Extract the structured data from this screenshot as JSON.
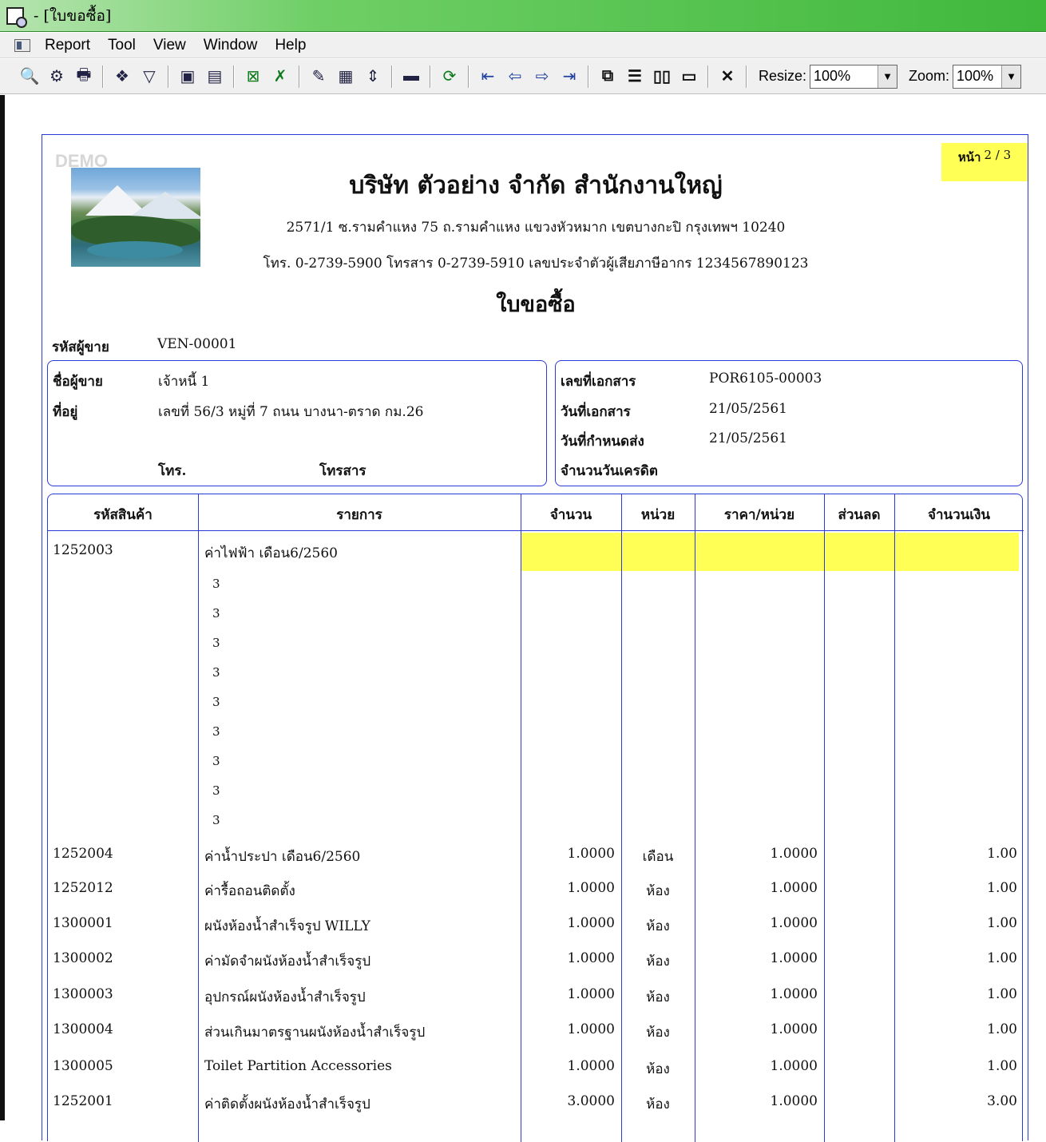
{
  "window": {
    "title": "- [ใบขอซื้อ]"
  },
  "menu": {
    "items": [
      "Report",
      "Tool",
      "View",
      "Window",
      "Help"
    ]
  },
  "toolbar": {
    "resize_label": "Resize:",
    "resize_value": "100%",
    "zoom_label": "Zoom:",
    "zoom_value": "100%",
    "buttons": [
      {
        "name": "preview-icon",
        "glyph": "🔍"
      },
      {
        "name": "setup-icon",
        "glyph": "⚙"
      },
      {
        "name": "print-icon",
        "glyph": "🖶"
      },
      {
        "name": "group-icon",
        "glyph": "❖"
      },
      {
        "name": "filter-icon",
        "glyph": "▽"
      },
      {
        "name": "save-icon",
        "glyph": "▣"
      },
      {
        "name": "export-icon",
        "glyph": "▤"
      },
      {
        "name": "excel-icon",
        "glyph": "⊠"
      },
      {
        "name": "excel-alt-icon",
        "glyph": "✗"
      },
      {
        "name": "paint-icon",
        "glyph": "✎"
      },
      {
        "name": "grid-icon",
        "glyph": "▦"
      },
      {
        "name": "fit-icon",
        "glyph": "⇕"
      },
      {
        "name": "calculator-icon",
        "glyph": "▬"
      },
      {
        "name": "refresh-icon",
        "glyph": "⟳"
      },
      {
        "name": "first-page-icon",
        "glyph": "⇤"
      },
      {
        "name": "prev-page-icon",
        "glyph": "⇦"
      },
      {
        "name": "next-page-icon",
        "glyph": "⇨"
      },
      {
        "name": "last-page-icon",
        "glyph": "⇥"
      },
      {
        "name": "multi-page-icon",
        "glyph": "⧉"
      },
      {
        "name": "single-page-icon",
        "glyph": "☰"
      },
      {
        "name": "two-page-icon",
        "glyph": "▯▯"
      },
      {
        "name": "window-icon",
        "glyph": "▭"
      },
      {
        "name": "close-icon",
        "glyph": "✕"
      }
    ]
  },
  "report": {
    "watermark": "DEMO",
    "page_label": "หน้า",
    "page_value": "2 / 3",
    "company": "บริษัท ตัวอย่าง จำกัด   สำนักงานใหญ่",
    "address": "2571/1 ซ.รามคำแหง 75 ถ.รามคำแหง แขวงหัวหมาก เขตบางกะปิ กรุงเทพฯ 10240",
    "contact": "โทร. 0-2739-5900  โทรสาร 0-2739-5910  เลขประจำตัวผู้เสียภาษีอากร 1234567890123",
    "doc_title": "ใบขอซื้อ",
    "vendor_code_label": "รหัสผู้ขาย",
    "vendor_code": "VEN-00001",
    "vendor_name_label": "ชื่อผู้ขาย",
    "vendor_name": "เจ้าหนี้ 1",
    "address_label": "ที่อยู่",
    "vendor_address": "เลขที่ 56/3 หมู่ที่ 7 ถนน บางนา-ตราด กม.26",
    "phone_label": "โทร.",
    "fax_label": "โทรสาร",
    "doc_no_label": "เลขที่เอกสาร",
    "doc_no": "POR6105-00003",
    "doc_date_label": "วันที่เอกสาร",
    "doc_date": "21/05/2561",
    "due_date_label": "วันที่กำหนดส่ง",
    "due_date": "21/05/2561",
    "credit_days_label": "จำนวนวันเครดิต",
    "columns": [
      "รหัสสินค้า",
      "รายการ",
      "จำนวน",
      "หน่วย",
      "ราคา/หน่วย",
      "ส่วนลด",
      "จำนวนเงิน"
    ],
    "rows": [
      {
        "code": "1252003",
        "desc": "ค่าไฟฟ้า เดือน6/2560",
        "qty": "",
        "unit": "",
        "price": "",
        "discount": "",
        "amount": ""
      },
      {
        "code": "",
        "desc": "3",
        "qty": "",
        "unit": "",
        "price": "",
        "discount": "",
        "amount": ""
      },
      {
        "code": "",
        "desc": "3",
        "qty": "",
        "unit": "",
        "price": "",
        "discount": "",
        "amount": ""
      },
      {
        "code": "",
        "desc": "3",
        "qty": "",
        "unit": "",
        "price": "",
        "discount": "",
        "amount": ""
      },
      {
        "code": "",
        "desc": "3",
        "qty": "",
        "unit": "",
        "price": "",
        "discount": "",
        "amount": ""
      },
      {
        "code": "",
        "desc": "3",
        "qty": "",
        "unit": "",
        "price": "",
        "discount": "",
        "amount": ""
      },
      {
        "code": "",
        "desc": "3",
        "qty": "",
        "unit": "",
        "price": "",
        "discount": "",
        "amount": ""
      },
      {
        "code": "",
        "desc": "3",
        "qty": "",
        "unit": "",
        "price": "",
        "discount": "",
        "amount": ""
      },
      {
        "code": "",
        "desc": "3",
        "qty": "",
        "unit": "",
        "price": "",
        "discount": "",
        "amount": ""
      },
      {
        "code": "",
        "desc": "3",
        "qty": "",
        "unit": "",
        "price": "",
        "discount": "",
        "amount": ""
      },
      {
        "code": "1252004",
        "desc": "ค่าน้ำประปา เดือน6/2560",
        "qty": "1.0000",
        "unit": "เดือน",
        "price": "1.0000",
        "discount": "",
        "amount": "1.00"
      },
      {
        "code": "1252012",
        "desc": "ค่ารื้อถอนติดตั้ง",
        "qty": "1.0000",
        "unit": "ห้อง",
        "price": "1.0000",
        "discount": "",
        "amount": "1.00"
      },
      {
        "code": "1300001",
        "desc": "ผนังห้องน้ำสำเร็จรูป WILLY",
        "qty": "1.0000",
        "unit": "ห้อง",
        "price": "1.0000",
        "discount": "",
        "amount": "1.00"
      },
      {
        "code": "1300002",
        "desc": "ค่ามัดจำผนังห้องน้ำสำเร็จรูป",
        "qty": "1.0000",
        "unit": "ห้อง",
        "price": "1.0000",
        "discount": "",
        "amount": "1.00"
      },
      {
        "code": "1300003",
        "desc": "อุปกรณ์ผนังห้องน้ำสำเร็จรูป",
        "qty": "1.0000",
        "unit": "ห้อง",
        "price": "1.0000",
        "discount": "",
        "amount": "1.00"
      },
      {
        "code": "1300004",
        "desc": "ส่วนเกินมาตรฐานผนังห้องน้ำสำเร็จรูป",
        "qty": "1.0000",
        "unit": "ห้อง",
        "price": "1.0000",
        "discount": "",
        "amount": "1.00"
      },
      {
        "code": "1300005",
        "desc": "Toilet Partition Accessories",
        "qty": "1.0000",
        "unit": "ห้อง",
        "price": "1.0000",
        "discount": "",
        "amount": "1.00"
      },
      {
        "code": "1252001",
        "desc": "ค่าติดตั้งผนังห้องน้ำสำเร็จรูป",
        "qty": "3.0000",
        "unit": "ห้อง",
        "price": "1.0000",
        "discount": "",
        "amount": "3.00"
      }
    ]
  }
}
